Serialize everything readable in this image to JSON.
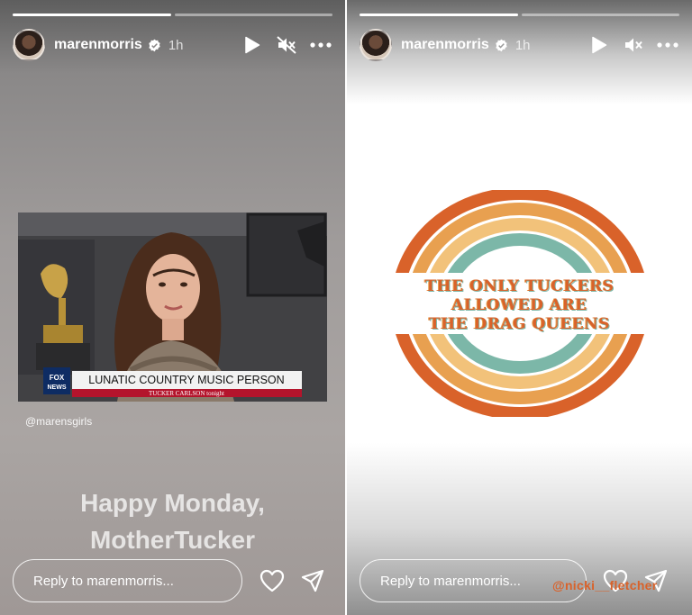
{
  "stories": [
    {
      "progress": [
        1,
        0
      ],
      "username": "marenmorris",
      "time": "1h",
      "mention": "@marensgirls",
      "caption": [
        "Happy Monday,",
        "MotherTucker"
      ],
      "reply_placeholder": "Reply to marenmorris...",
      "photo": {
        "banner": "LUNATIC COUNTRY MUSIC PERSON",
        "subbanner": "TUCKER CARLSON tonight",
        "channel": "FOX NEWS"
      }
    },
    {
      "progress": [
        1,
        0
      ],
      "username": "marenmorris",
      "time": "1h",
      "artwork_lines": [
        "THE ONLY TUCKERS",
        "ALLOWED ARE",
        "THE DRAG QUEENS"
      ],
      "sticker": "@nicki__fletcher",
      "reply_placeholder": "Reply to marenmorris..."
    }
  ],
  "colors": {
    "rainbow": [
      "#d9622a",
      "#e8a050",
      "#f2c27a",
      "#7cb7a8"
    ]
  },
  "icons": [
    "play-icon",
    "mute-icon",
    "more-icon",
    "verified-icon",
    "heart-icon",
    "send-icon"
  ]
}
